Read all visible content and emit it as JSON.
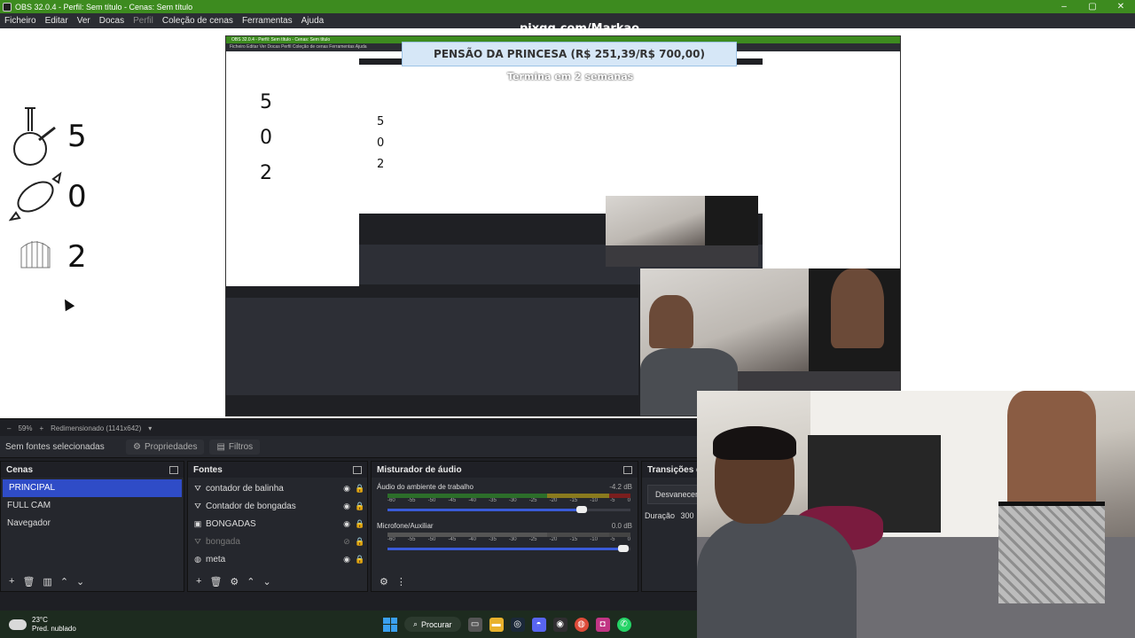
{
  "titlebar": {
    "title": "OBS 32.0.4 - Perfil: Sem título - Cenas: Sem título",
    "controls": [
      "–",
      "▢",
      "✕"
    ]
  },
  "menu": [
    "Ficheiro",
    "Editar",
    "Ver",
    "Docas",
    "Perfil",
    "Coleção de cenas",
    "Ferramentas",
    "Ajuda"
  ],
  "overlay_url": "pixgg.com/Markao",
  "counters": [
    {
      "icon": "bong-icon",
      "value": "5"
    },
    {
      "icon": "candy-icon",
      "value": "0"
    },
    {
      "icon": "cage-icon",
      "value": "2"
    }
  ],
  "banner": {
    "text": "PENSÃO DA PRINCESA (R$ 251,39/R$ 700,00)",
    "subtext": "Termina em 2 semanas"
  },
  "nested": {
    "title": "OBS 32.0.4 - Perfil: Sem título - Cenas: Sem título",
    "menu": "Ficheiro  Editar  Ver  Docas  Perfil  Coleção de cenas  Ferramentas  Ajuda"
  },
  "status": {
    "zoom": "59%",
    "mode": "Redimensionado (1141x642)"
  },
  "toolbar": {
    "no_sources": "Sem fontes selecionadas",
    "properties": "Propriedades",
    "filters": "Filtros"
  },
  "scenes": {
    "title": "Cenas",
    "items": [
      {
        "label": "PRINCIPAL",
        "selected": true
      },
      {
        "label": "FULL CAM"
      },
      {
        "label": "Navegador"
      }
    ]
  },
  "sources": {
    "title": "Fontes",
    "items": [
      {
        "label": "contador de balinha",
        "icon": "browser-icon",
        "visible": true
      },
      {
        "label": "Contador de bongadas",
        "icon": "browser-icon",
        "visible": true
      },
      {
        "label": "BONGADAS",
        "icon": "image-icon",
        "visible": true
      },
      {
        "label": "bongada",
        "icon": "browser-icon",
        "visible": false
      },
      {
        "label": "meta",
        "icon": "globe-icon",
        "visible": true
      }
    ]
  },
  "mixer": {
    "title": "Misturador de áudio",
    "ticks": [
      "-60",
      "-55",
      "-50",
      "-45",
      "-40",
      "-35",
      "-30",
      "-25",
      "-20",
      "-15",
      "-10",
      "-5",
      "0"
    ],
    "channels": [
      {
        "name": "Áudio do ambiente de trabalho",
        "db": "-4.2 dB",
        "volume": 0.8
      },
      {
        "name": "Microfone/Auxiliar",
        "db": "0.0 dB",
        "volume": 0.97
      }
    ]
  },
  "transitions": {
    "title": "Transições de",
    "button": "Desvanecer",
    "duration_label": "Duração",
    "duration_value": "300"
  },
  "taskbar": {
    "temperature": "23°C",
    "weather": "Pred. nublado",
    "search": "Procurar"
  },
  "colors": {
    "accent": "#3d8b1f",
    "selection": "#2f4cc7",
    "panel": "#25272d"
  }
}
